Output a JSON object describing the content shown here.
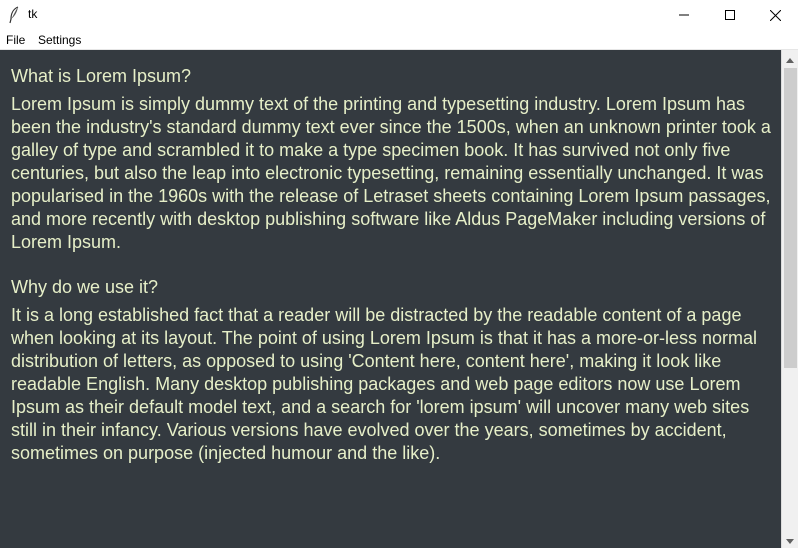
{
  "window": {
    "title": "tk",
    "icon": "feather-icon",
    "controls": [
      "minimize-icon",
      "maximize-icon",
      "close-icon"
    ]
  },
  "menubar": {
    "file_label": "File",
    "settings_label": "Settings"
  },
  "editor": {
    "background": "#343a40",
    "text_color": "#e6efc8",
    "sections": [
      {
        "heading": "What is Lorem Ipsum?",
        "body": "Lorem Ipsum is simply dummy text of the printing and typesetting industry. Lorem Ipsum has been the industry's standard dummy text ever since the 1500s, when an unknown printer took a galley of type and scrambled it to make a type specimen book. It has survived not only five centuries, but also the leap into electronic typesetting, remaining essentially unchanged. It was popularised in the 1960s with the release of Letraset sheets containing Lorem Ipsum passages, and more recently with desktop publishing software like Aldus PageMaker including versions of Lorem Ipsum."
      },
      {
        "heading": "Why do we use it?",
        "body": "It is a long established fact that a reader will be distracted by the readable content of a page when looking at its layout. The point of using Lorem Ipsum is that it has a more-or-less normal distribution of letters, as opposed to using 'Content here, content here', making it look like readable English. Many desktop publishing packages and web page editors now use Lorem Ipsum as their default model text, and a search for 'lorem ipsum' will uncover many web sites still in their infancy. Various versions have evolved over the years, sometimes by accident, sometimes on purpose (injected humour and the like)."
      }
    ]
  },
  "scrollbar": {
    "up_icon": "scroll-up-arrow-icon",
    "down_icon": "scroll-down-arrow-icon"
  }
}
